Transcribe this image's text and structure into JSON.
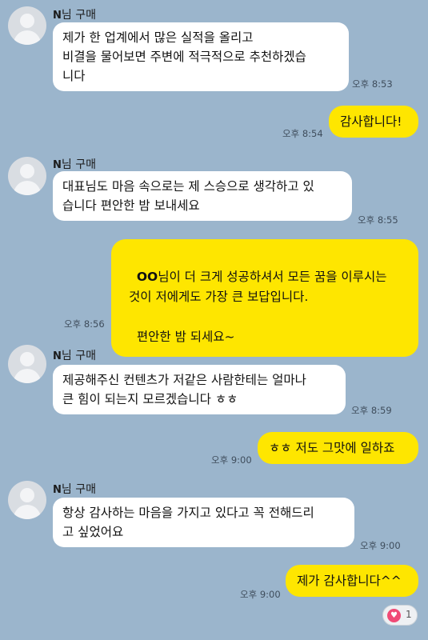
{
  "messages": [
    {
      "type": "in",
      "sender_initial": "N",
      "sender_rest": "님 구매",
      "text": "제가 한 업계에서 많은 실적을 올리고\n비결을 물어보면 주변에 적극적으로 추천하겠습\n니다",
      "time": "오후 8:53"
    },
    {
      "type": "out",
      "text": "감사합니다!",
      "time": "오후 8:54"
    },
    {
      "type": "in",
      "sender_initial": "N",
      "sender_rest": "님 구매",
      "text": "대표님도 마음 속으로는 제 스승으로 생각하고 있\n습니다 편안한 밤 보내세요",
      "time": "오후 8:55"
    },
    {
      "type": "out",
      "text_bold": "OO",
      "text": "님이 더 크게 성공하셔서 모든 꿈을 이루시는\n것이 저에게도 가장 큰 보답입니다.\n\n  편안한 밤 되세요~",
      "time": "오후 8:56"
    },
    {
      "type": "in",
      "sender_initial": "N",
      "sender_rest": "님 구매",
      "text": "제공해주신 컨텐츠가 저같은 사람한테는 얼마나\n큰 힘이 되는지 모르겠습니다 ㅎㅎ",
      "time": "오후 8:59"
    },
    {
      "type": "out",
      "text": "ㅎㅎ 저도 그맛에 일하죠",
      "time": "오후 9:00"
    },
    {
      "type": "in",
      "sender_initial": "N",
      "sender_rest": "님 구매",
      "text": "항상 감사하는 마음을 가지고 있다고 꼭 전해드리\n고 싶었어요",
      "time": "오후 9:00"
    },
    {
      "type": "out",
      "text": "제가 감사합니다^^",
      "time": "오후 9:00"
    }
  ],
  "reaction": {
    "icon": "heart-icon",
    "count": "1"
  },
  "colors": {
    "background": "#9bb5cc",
    "outgoing": "#fee600",
    "incoming": "#ffffff",
    "heart": "#f04a76"
  }
}
